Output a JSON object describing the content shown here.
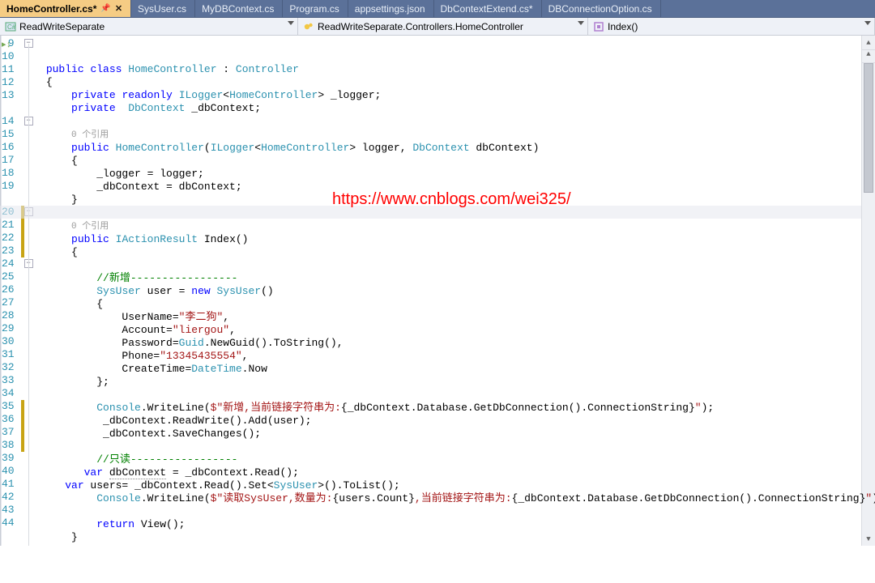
{
  "tabs": [
    {
      "label": "HomeController.cs*",
      "active": true,
      "pinned": true
    },
    {
      "label": "SysUser.cs"
    },
    {
      "label": "MyDBContext.cs"
    },
    {
      "label": "Program.cs"
    },
    {
      "label": "appsettings.json"
    },
    {
      "label": "DbContextExtend.cs*"
    },
    {
      "label": "DBConnectionOption.cs"
    }
  ],
  "nav": {
    "project": "ReadWriteSeparate",
    "scope": "ReadWriteSeparate.Controllers.HomeController",
    "member": "Index()"
  },
  "watermark": "https://www.cnblogs.com/wei325/",
  "highlight_line_index": 13,
  "line_numbers": [
    "9",
    "10",
    "11",
    "12",
    "13",
    "",
    "14",
    "15",
    "16",
    "17",
    "18",
    "19",
    "",
    "20",
    "21",
    "22",
    "23",
    "24",
    "25",
    "26",
    "27",
    "28",
    "29",
    "30",
    "31",
    "32",
    "33",
    "34",
    "35",
    "36",
    "37",
    "38",
    "39",
    "40",
    "41",
    "42",
    "43",
    "44"
  ],
  "fold_markers": [
    {
      "row": 0,
      "sym": "−"
    },
    {
      "row": 6,
      "sym": "−"
    },
    {
      "row": 13,
      "sym": "−"
    },
    {
      "row": 17,
      "sym": "−"
    }
  ],
  "change_marks": [
    {
      "row_from": 13,
      "row_to": 16
    },
    {
      "row_from": 28,
      "row_to": 31
    }
  ],
  "code_lines": [
    [
      [
        "    "
      ],
      [
        "k",
        "public"
      ],
      [
        " "
      ],
      [
        "k",
        "class"
      ],
      [
        " "
      ],
      [
        "t",
        "HomeController"
      ],
      [
        " : "
      ],
      [
        "t",
        "Controller"
      ]
    ],
    [
      [
        "    {"
      ]
    ],
    [
      [
        "        "
      ],
      [
        "k",
        "private"
      ],
      [
        " "
      ],
      [
        "k",
        "readonly"
      ],
      [
        " "
      ],
      [
        "t",
        "ILogger"
      ],
      [
        "<"
      ],
      [
        "t",
        "HomeController"
      ],
      [
        "> _logger;"
      ]
    ],
    [
      [
        "        "
      ],
      [
        "k",
        "private"
      ],
      [
        "  "
      ],
      [
        "t",
        "DbContext"
      ],
      [
        " _dbContext;"
      ]
    ],
    [
      [
        " "
      ]
    ],
    [
      [
        "        "
      ],
      [
        "ann",
        "0 个引用"
      ]
    ],
    [
      [
        "        "
      ],
      [
        "k",
        "public"
      ],
      [
        " "
      ],
      [
        "t",
        "HomeController"
      ],
      [
        "("
      ],
      [
        "t",
        "ILogger"
      ],
      [
        "<"
      ],
      [
        "t",
        "HomeController"
      ],
      [
        "> logger, "
      ],
      [
        "t",
        "DbContext"
      ],
      [
        " dbContext)"
      ]
    ],
    [
      [
        "        {"
      ]
    ],
    [
      [
        "            _logger = logger;"
      ]
    ],
    [
      [
        "            _dbContext = dbContext;"
      ]
    ],
    [
      [
        "        }"
      ]
    ],
    [
      [
        " "
      ]
    ],
    [
      [
        "        "
      ],
      [
        "ann",
        "0 个引用"
      ]
    ],
    [
      [
        "        "
      ],
      [
        "k",
        "public"
      ],
      [
        " "
      ],
      [
        "t",
        "IActionResult"
      ],
      [
        " Index()"
      ]
    ],
    [
      [
        "        {"
      ]
    ],
    [
      [
        " "
      ]
    ],
    [
      [
        "            "
      ],
      [
        "c",
        "//新增-----------------"
      ]
    ],
    [
      [
        "            "
      ],
      [
        "t",
        "SysUser"
      ],
      [
        " user = "
      ],
      [
        "k",
        "new"
      ],
      [
        " "
      ],
      [
        "t",
        "SysUser"
      ],
      [
        "()"
      ]
    ],
    [
      [
        "            {"
      ]
    ],
    [
      [
        "                UserName="
      ],
      [
        "s",
        "\"李二狗\""
      ],
      [
        ","
      ]
    ],
    [
      [
        "                Account="
      ],
      [
        "s",
        "\"liergou\""
      ],
      [
        ","
      ]
    ],
    [
      [
        "                Password="
      ],
      [
        "t",
        "Guid"
      ],
      [
        ".NewGuid().ToString(),"
      ]
    ],
    [
      [
        "                Phone="
      ],
      [
        "s",
        "\"13345435554\""
      ],
      [
        ","
      ]
    ],
    [
      [
        "                CreateTime="
      ],
      [
        "t",
        "DateTime"
      ],
      [
        ".Now"
      ]
    ],
    [
      [
        "            };"
      ]
    ],
    [
      [
        " "
      ]
    ],
    [
      [
        "            "
      ],
      [
        "t",
        "Console"
      ],
      [
        ".WriteLine("
      ],
      [
        "s",
        "$\"新增,当前链接字符串为:"
      ],
      [
        "{_dbContext.Database.GetDbConnection().ConnectionString}"
      ],
      [
        "s",
        "\""
      ],
      [
        ");"
      ]
    ],
    [
      [
        "             _dbContext.ReadWrite().Add(user);"
      ]
    ],
    [
      [
        "             _dbContext.SaveChanges();"
      ]
    ],
    [
      [
        " "
      ]
    ],
    [
      [
        "            "
      ],
      [
        "c",
        "//只读-----------------"
      ]
    ],
    [
      [
        "          "
      ],
      [
        "k",
        "var"
      ],
      [
        " "
      ],
      [
        "squig",
        "dbContext"
      ],
      [
        " = _dbContext.Read();"
      ]
    ],
    [
      [
        "       "
      ],
      [
        "k",
        "var"
      ],
      [
        " users= _dbContext.Read().Set<"
      ],
      [
        "t",
        "SysUser"
      ],
      [
        ">().ToList();"
      ]
    ],
    [
      [
        "            "
      ],
      [
        "t",
        "Console"
      ],
      [
        ".WriteLine("
      ],
      [
        "s",
        "$\"读取SysUser,数量为:"
      ],
      [
        "{users.Count}"
      ],
      [
        "s",
        ",当前链接字符串为:"
      ],
      [
        "{_dbContext.Database.GetDbConnection().ConnectionString}"
      ],
      [
        "s",
        "\""
      ],
      [
        ");"
      ]
    ],
    [
      [
        " "
      ]
    ],
    [
      [
        "            "
      ],
      [
        "k",
        "return"
      ],
      [
        " View();"
      ]
    ],
    [
      [
        "        }"
      ]
    ],
    [
      [
        " "
      ]
    ]
  ]
}
